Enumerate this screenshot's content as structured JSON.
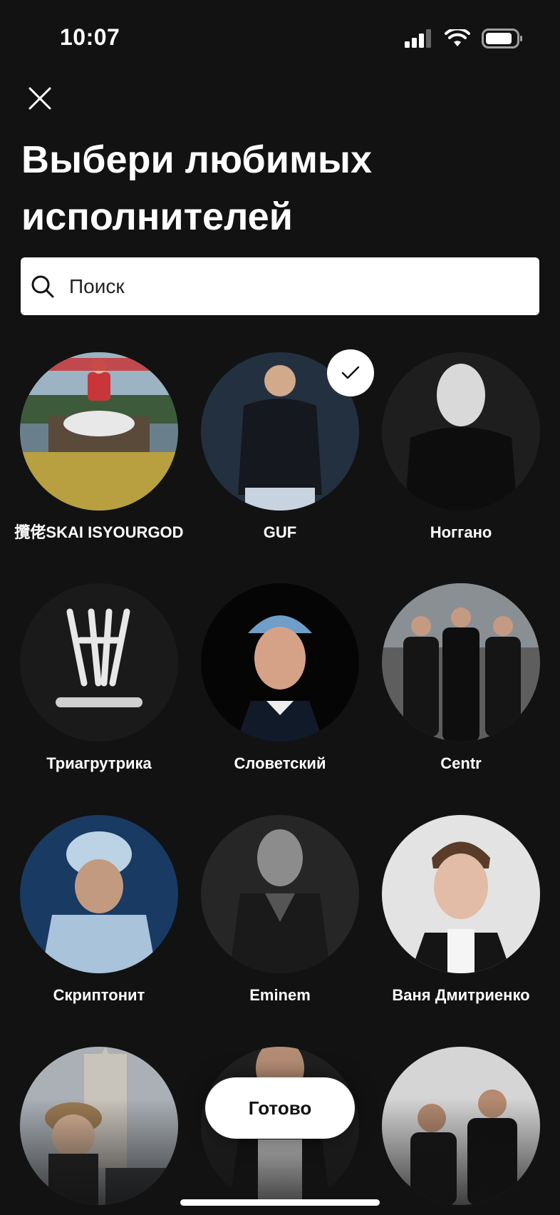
{
  "status_bar": {
    "time": "10:07"
  },
  "header": {
    "title": "Выбери любимых исполнителей"
  },
  "search": {
    "placeholder": "Поиск"
  },
  "artists": [
    {
      "name": "攬佬SKAI ISYOURGOD",
      "selected": false
    },
    {
      "name": "GUF",
      "selected": true
    },
    {
      "name": "Ноггано",
      "selected": false
    },
    {
      "name": "Триагрутрика",
      "selected": false
    },
    {
      "name": "Словетский",
      "selected": false
    },
    {
      "name": "Centr",
      "selected": false
    },
    {
      "name": "Скриптонит",
      "selected": false
    },
    {
      "name": "Eminem",
      "selected": false
    },
    {
      "name": "Ваня Дмитриенко",
      "selected": false
    },
    {
      "name": "",
      "selected": false
    },
    {
      "name": "",
      "selected": false
    },
    {
      "name": "",
      "selected": false
    }
  ],
  "footer": {
    "done_label": "Готово"
  },
  "colors": {
    "background": "#121212",
    "text": "#ffffff",
    "button_bg": "#ffffff",
    "button_text": "#121212"
  }
}
